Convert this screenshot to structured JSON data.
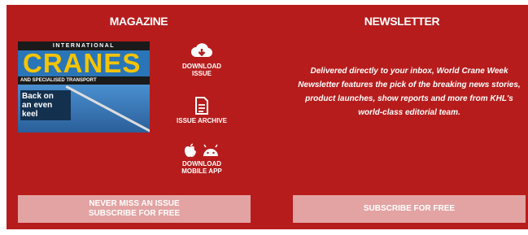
{
  "magazine": {
    "heading": "MAGAZINE",
    "cover": {
      "top_text": "INTERNATIONAL",
      "title": "CRANES",
      "subtitle": "AND SPECIALISED TRANSPORT",
      "headline_line1": "Back on",
      "headline_line2": "an even",
      "headline_line3": "keel"
    },
    "download_issue": {
      "icon": "cloud-download-icon",
      "line1": "DOWNLOAD",
      "line2": "ISSUE"
    },
    "issue_archive": {
      "icon": "document-icon",
      "label": "ISSUE ARCHIVE"
    },
    "mobile_app": {
      "icons": [
        "apple-icon",
        "android-icon"
      ],
      "line1": "DOWNLOAD",
      "line2": "MOBILE APP"
    },
    "cta_line1": "NEVER MISS AN ISSUE",
    "cta_line2": "SUBSCRIBE FOR FREE"
  },
  "newsletter": {
    "heading": "NEWSLETTER",
    "description": "Delivered directly to your inbox, World Crane Week Newsletter features the pick of the breaking news stories, product launches, show reports and more from KHL's world-class editorial team.",
    "cta": "SUBSCRIBE FOR FREE"
  },
  "colors": {
    "panel": "#b71c1c",
    "button": "#e3a3a3"
  }
}
